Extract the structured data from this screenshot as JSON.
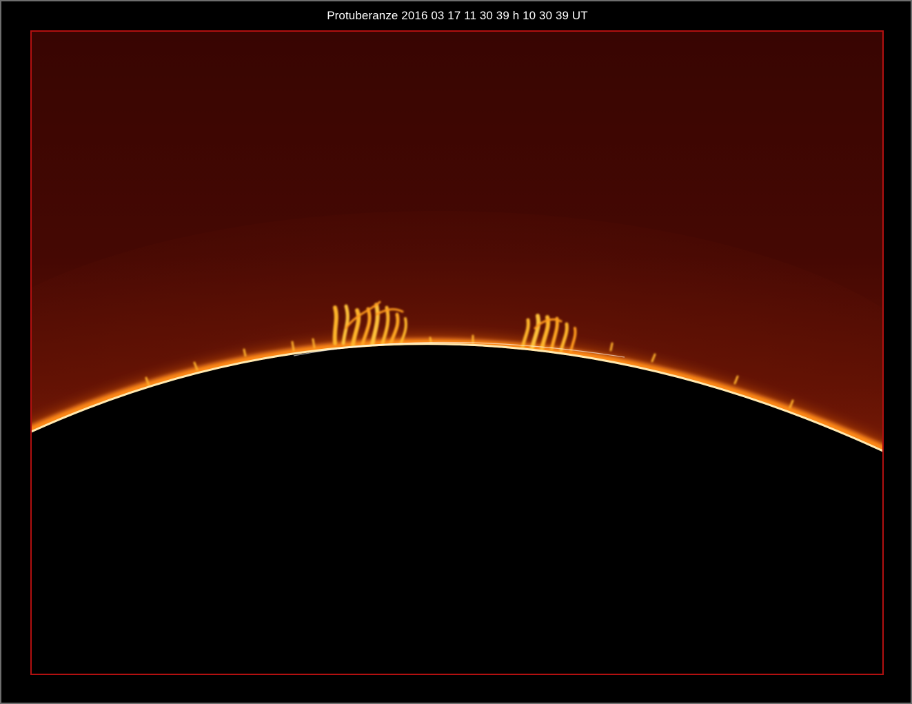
{
  "caption": "Protuberanze 2016 03 17 11 30 39 h 10 30 39 UT",
  "colors": {
    "background": "#000000",
    "outer_border": "#6e6e6e",
    "photo_border": "#b31010",
    "sky_top": "#3a0603",
    "sky_bottom": "#7a1c06",
    "chromosphere": "#ff9a1a",
    "limb_highlight": "#fff1c8",
    "solar_disk": "#000000"
  },
  "image": {
    "subject": "solar limb with prominences (H-alpha)"
  }
}
